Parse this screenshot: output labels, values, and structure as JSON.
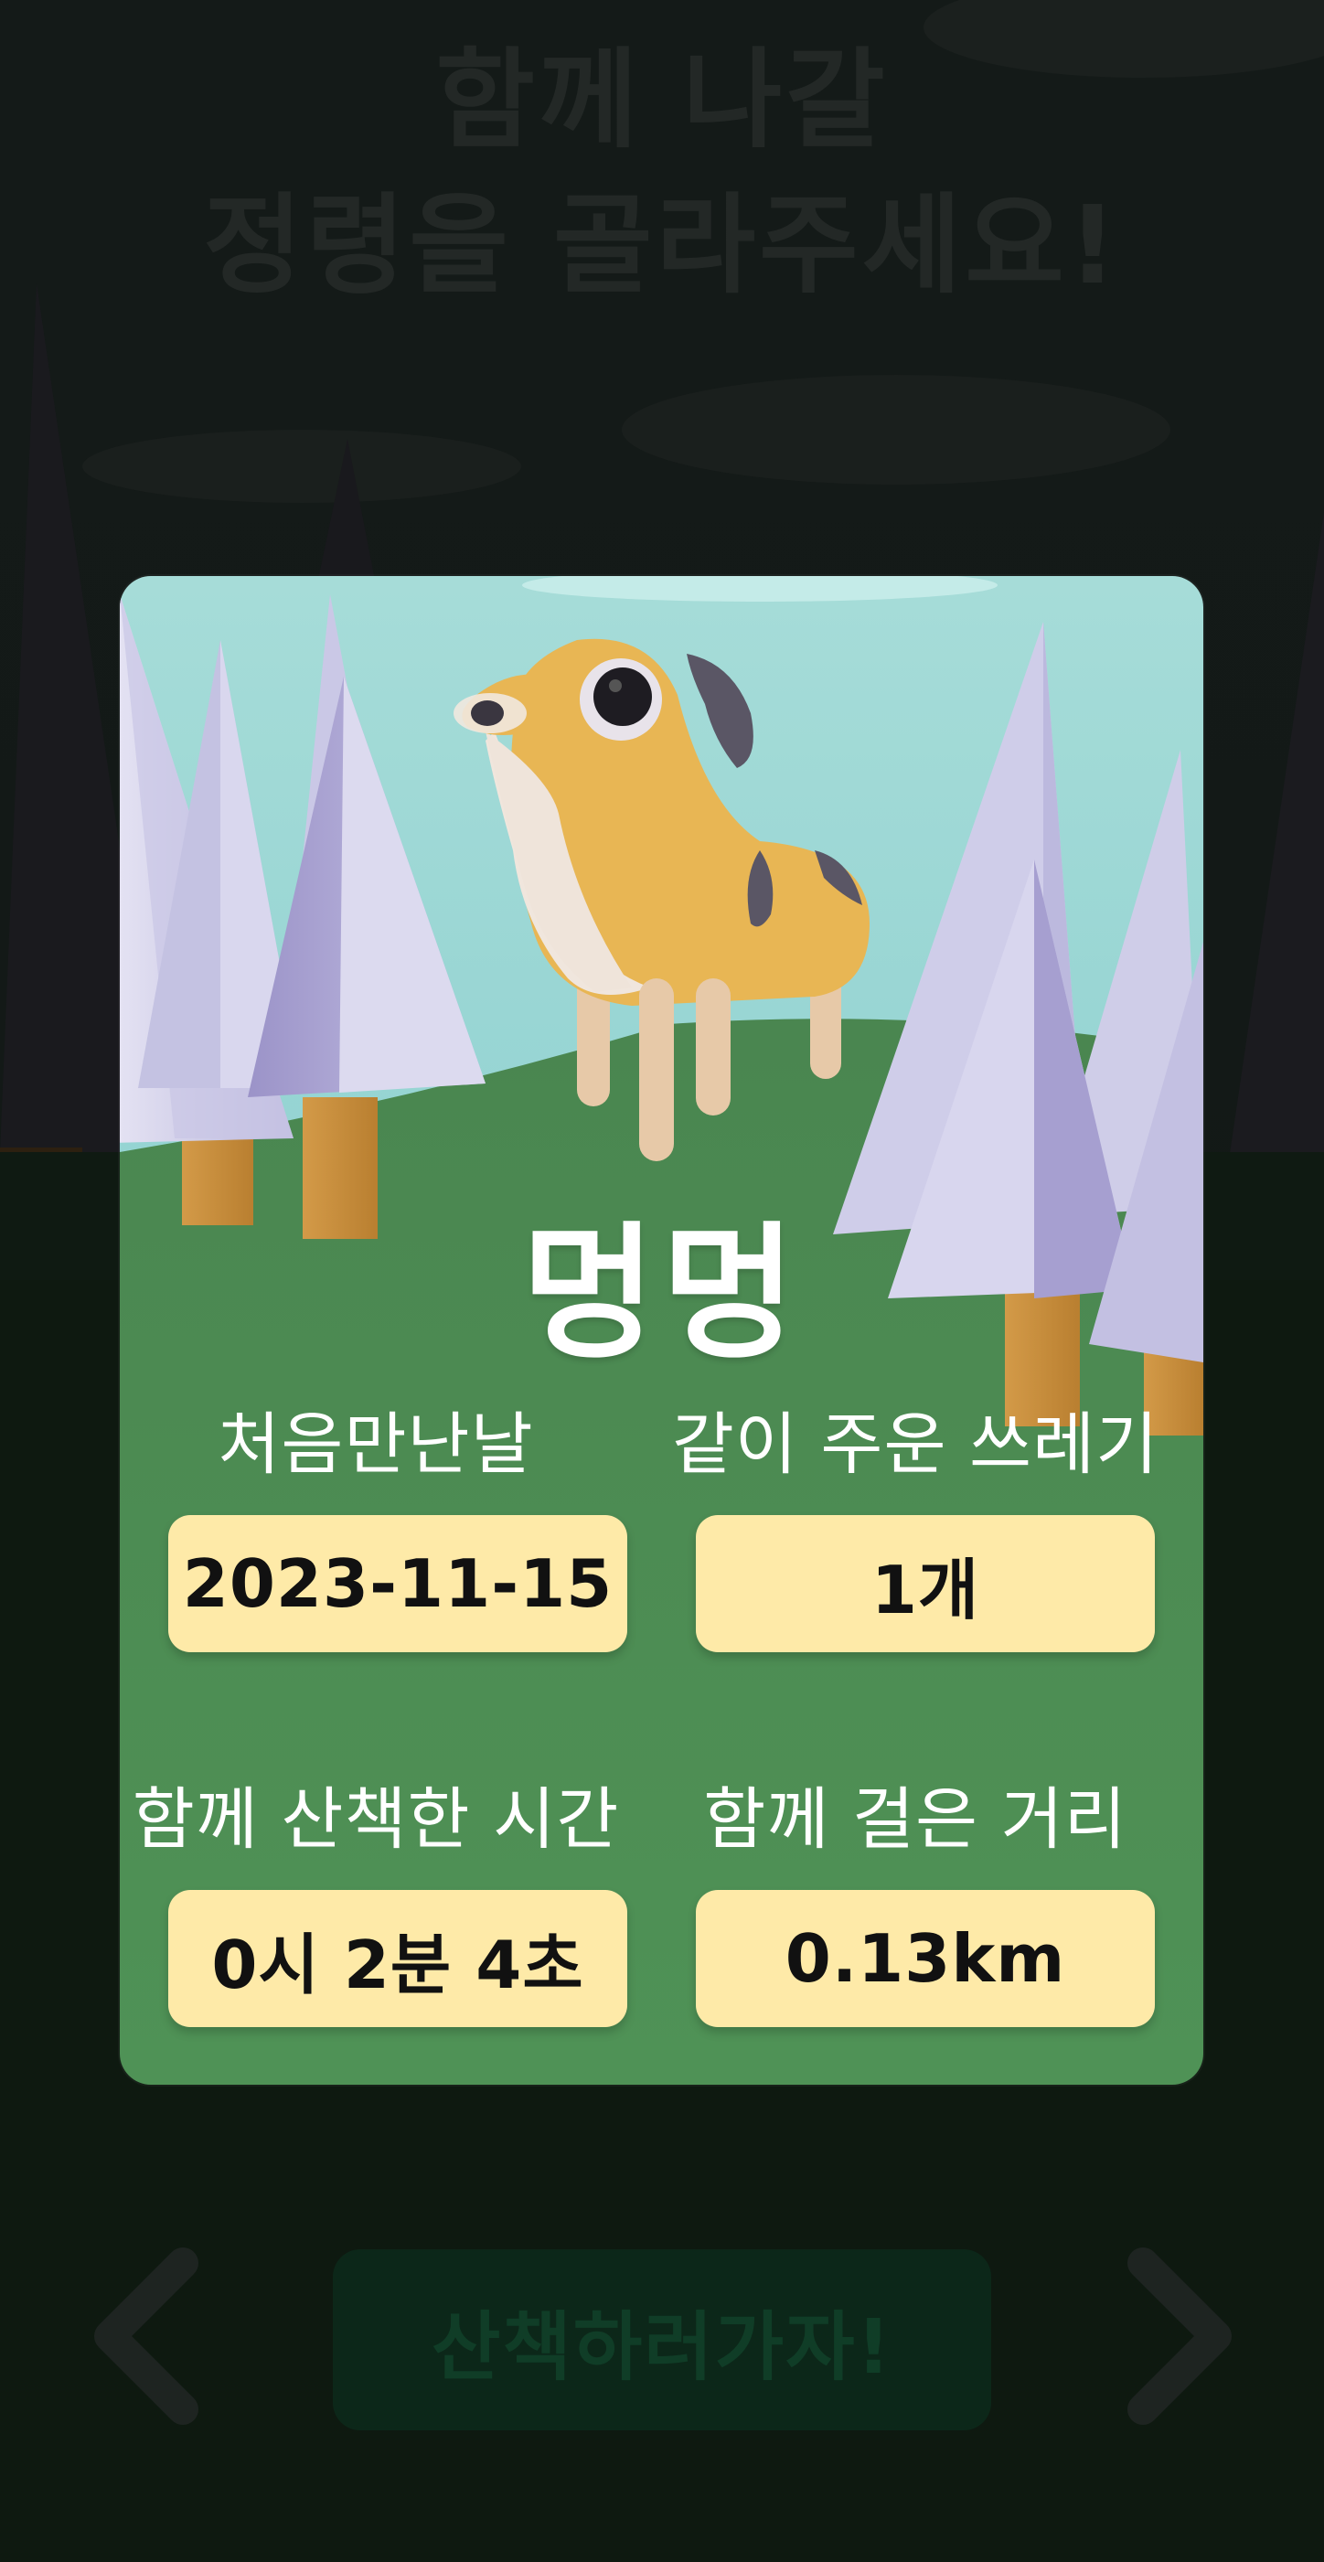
{
  "background": {
    "title_lines": [
      "함께 나갈",
      "정령을 골라주세요!"
    ],
    "cta_label": "산책하러가자!",
    "prev_icon": "chevron-left-icon",
    "next_icon": "chevron-right-icon"
  },
  "card": {
    "pet_name": "멍멍",
    "stats": [
      {
        "label": "처음만난날",
        "value": "2023-11-15"
      },
      {
        "label": "같이 주운 쓰레기",
        "value": "1개"
      },
      {
        "label": "함께 산책한 시간",
        "value": "0시 2분 4초"
      },
      {
        "label": "함께 걸은 거리",
        "value": "0.13km"
      }
    ]
  },
  "colors": {
    "stat_box": "#feeaa8",
    "grass": "#4e8a55",
    "sky": "#9fd9d6",
    "dog_body": "#e8b654"
  }
}
